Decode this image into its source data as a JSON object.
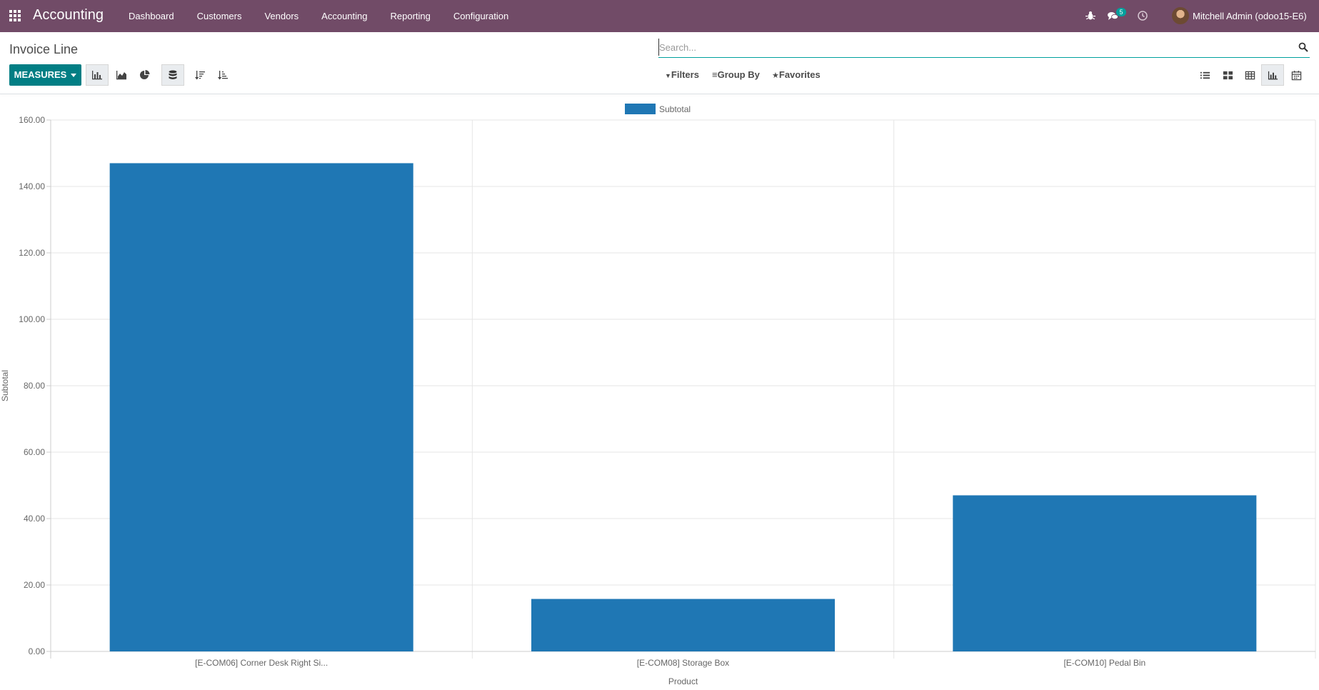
{
  "navbar": {
    "brand": "Accounting",
    "menu": [
      "Dashboard",
      "Customers",
      "Vendors",
      "Accounting",
      "Reporting",
      "Configuration"
    ],
    "messages_badge": "5",
    "user": "Mitchell Admin (odoo15-E6)",
    "icons": [
      "apps-grid-icon",
      "bug-icon",
      "chat-icon",
      "clock-icon"
    ]
  },
  "control_panel": {
    "title": "Invoice Line",
    "search_placeholder": "Search...",
    "measures_label": "MEASURES",
    "filters_label": "Filters",
    "groupby_label": "Group By",
    "favorites_label": "Favorites",
    "chart_tools": [
      "bar-chart-icon",
      "line-chart-icon",
      "pie-chart-icon",
      "stacked-icon",
      "sort-descending-icon",
      "sort-ascending-icon"
    ],
    "views": [
      "list-view-icon",
      "kanban-view-icon",
      "pivot-view-icon",
      "graph-view-icon",
      "calendar-view-icon"
    ],
    "active_view": "graph-view-icon"
  },
  "colors": {
    "navbar": "#714b67",
    "primary": "#017e84",
    "bar": "#1f77b4"
  },
  "chart_data": {
    "type": "bar",
    "categories": [
      "[E-COM06] Corner Desk Right Si...",
      "[E-COM08] Storage Box",
      "[E-COM10] Pedal Bin"
    ],
    "series": [
      {
        "name": "Subtotal",
        "values": [
          147.0,
          15.8,
          47.0
        ]
      }
    ],
    "xlabel": "Product",
    "ylabel": "Subtotal",
    "ylim": [
      0,
      160
    ],
    "yticks": [
      "0.00",
      "20.00",
      "40.00",
      "60.00",
      "80.00",
      "100.00",
      "120.00",
      "140.00",
      "160.00"
    ],
    "grid": true,
    "legend": "top-center"
  }
}
